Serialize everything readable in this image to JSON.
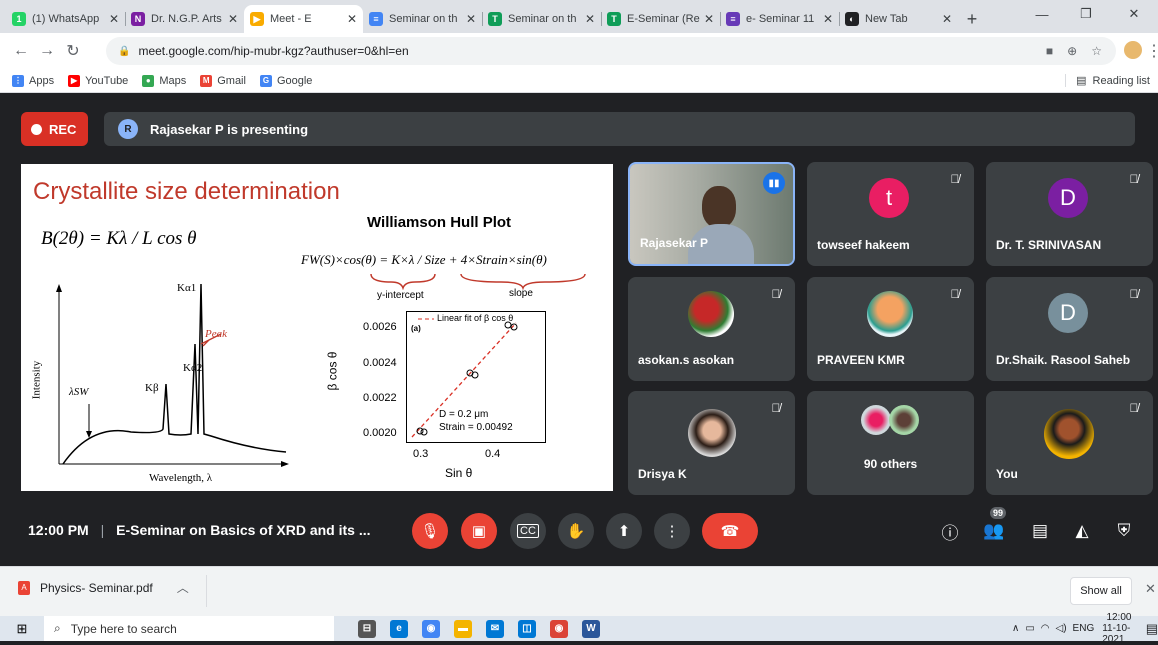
{
  "tabs": [
    {
      "title": "(1) WhatsApp",
      "color": "#25d366",
      "glyph": "1"
    },
    {
      "title": "Dr. N.G.P. Arts",
      "color": "#7b1fa2",
      "glyph": "N"
    },
    {
      "title": "Meet - E",
      "color": "#f9ab00",
      "glyph": "▶",
      "active": true
    },
    {
      "title": "Seminar on th",
      "color": "#4285f4",
      "glyph": "≡"
    },
    {
      "title": "Seminar on th",
      "color": "#0f9d58",
      "glyph": "T"
    },
    {
      "title": "E-Seminar (Re",
      "color": "#0f9d58",
      "glyph": "T"
    },
    {
      "title": "e- Seminar 11",
      "color": "#673ab7",
      "glyph": "≡"
    },
    {
      "title": "New Tab",
      "color": "#202124",
      "glyph": "◐"
    }
  ],
  "address": {
    "url": "meet.google.com/hip-mubr-kgz?authuser=0&hl=en"
  },
  "bookmarks": [
    {
      "label": "Apps",
      "color": "#4285f4",
      "glyph": "⋮"
    },
    {
      "label": "YouTube",
      "color": "#ff0000",
      "glyph": "▶"
    },
    {
      "label": "Maps",
      "color": "#34a853",
      "glyph": "●"
    },
    {
      "label": "Gmail",
      "color": "#ea4335",
      "glyph": "M"
    },
    {
      "label": "Google",
      "color": "#4285f4",
      "glyph": "G"
    }
  ],
  "reading_list": "Reading list",
  "meet": {
    "rec_label": "REC",
    "presenter_initial": "R",
    "presenting_text": "Rajasekar P is presenting",
    "slide": {
      "title": "Crystallite size determination",
      "formula": "B(2θ) = Kλ / L cos θ",
      "plot_title": "Williamson Hull Plot",
      "equation": "FW(S)×cos(θ) = K×λ / Size + 4×Strain×sin(θ)",
      "y_intercept": "y-intercept",
      "slope": "slope",
      "spectrum": {
        "ylabel": "Intensity",
        "xlabel": "Wavelength, λ",
        "peak_sw": "λSW",
        "peak_kb": "Kβ",
        "peak_ka1": "Kα1",
        "peak_ka2": "Kα2",
        "note": "Peak"
      },
      "whplot": {
        "legend": "Linear fit of β cos θ",
        "panel": "(a)",
        "ylabel": "β cos θ",
        "xlabel": "Sin θ",
        "D": "D = 0.2 μm",
        "strain": "Strain = 0.00492",
        "yticks": [
          "0.0026",
          "0.0024",
          "0.0022",
          "0.0020"
        ],
        "xticks": [
          "0.3",
          "0.4"
        ]
      }
    },
    "participants": [
      {
        "name": "Rajasekar P",
        "type": "video"
      },
      {
        "name": "towseef hakeem",
        "initial": "t",
        "color": "#e91e63"
      },
      {
        "name": "Dr. T. SRINIVASAN",
        "initial": "D",
        "color": "#7b1fa2"
      },
      {
        "name": "asokan.s asokan",
        "type": "photo-flowers"
      },
      {
        "name": "PRAVEEN KMR",
        "type": "photo-cartoon"
      },
      {
        "name": "Dr.Shaik. Rasool Saheb",
        "initial": "D",
        "color": "#78909c"
      },
      {
        "name": "Drisya K",
        "type": "photo-woman"
      },
      {
        "name": "90 others",
        "type": "group"
      },
      {
        "name": "You",
        "type": "photo-you"
      }
    ],
    "clock": "12:00 PM",
    "meeting_title": "E-Seminar on Basics of XRD and its ...",
    "people_badge": "99"
  },
  "download": {
    "file": "Physics- Seminar.pdf",
    "show_all": "Show all"
  },
  "taskbar": {
    "search": "Type here to search",
    "lang": "ENG",
    "time": "12:00",
    "date": "11-10-2021"
  }
}
